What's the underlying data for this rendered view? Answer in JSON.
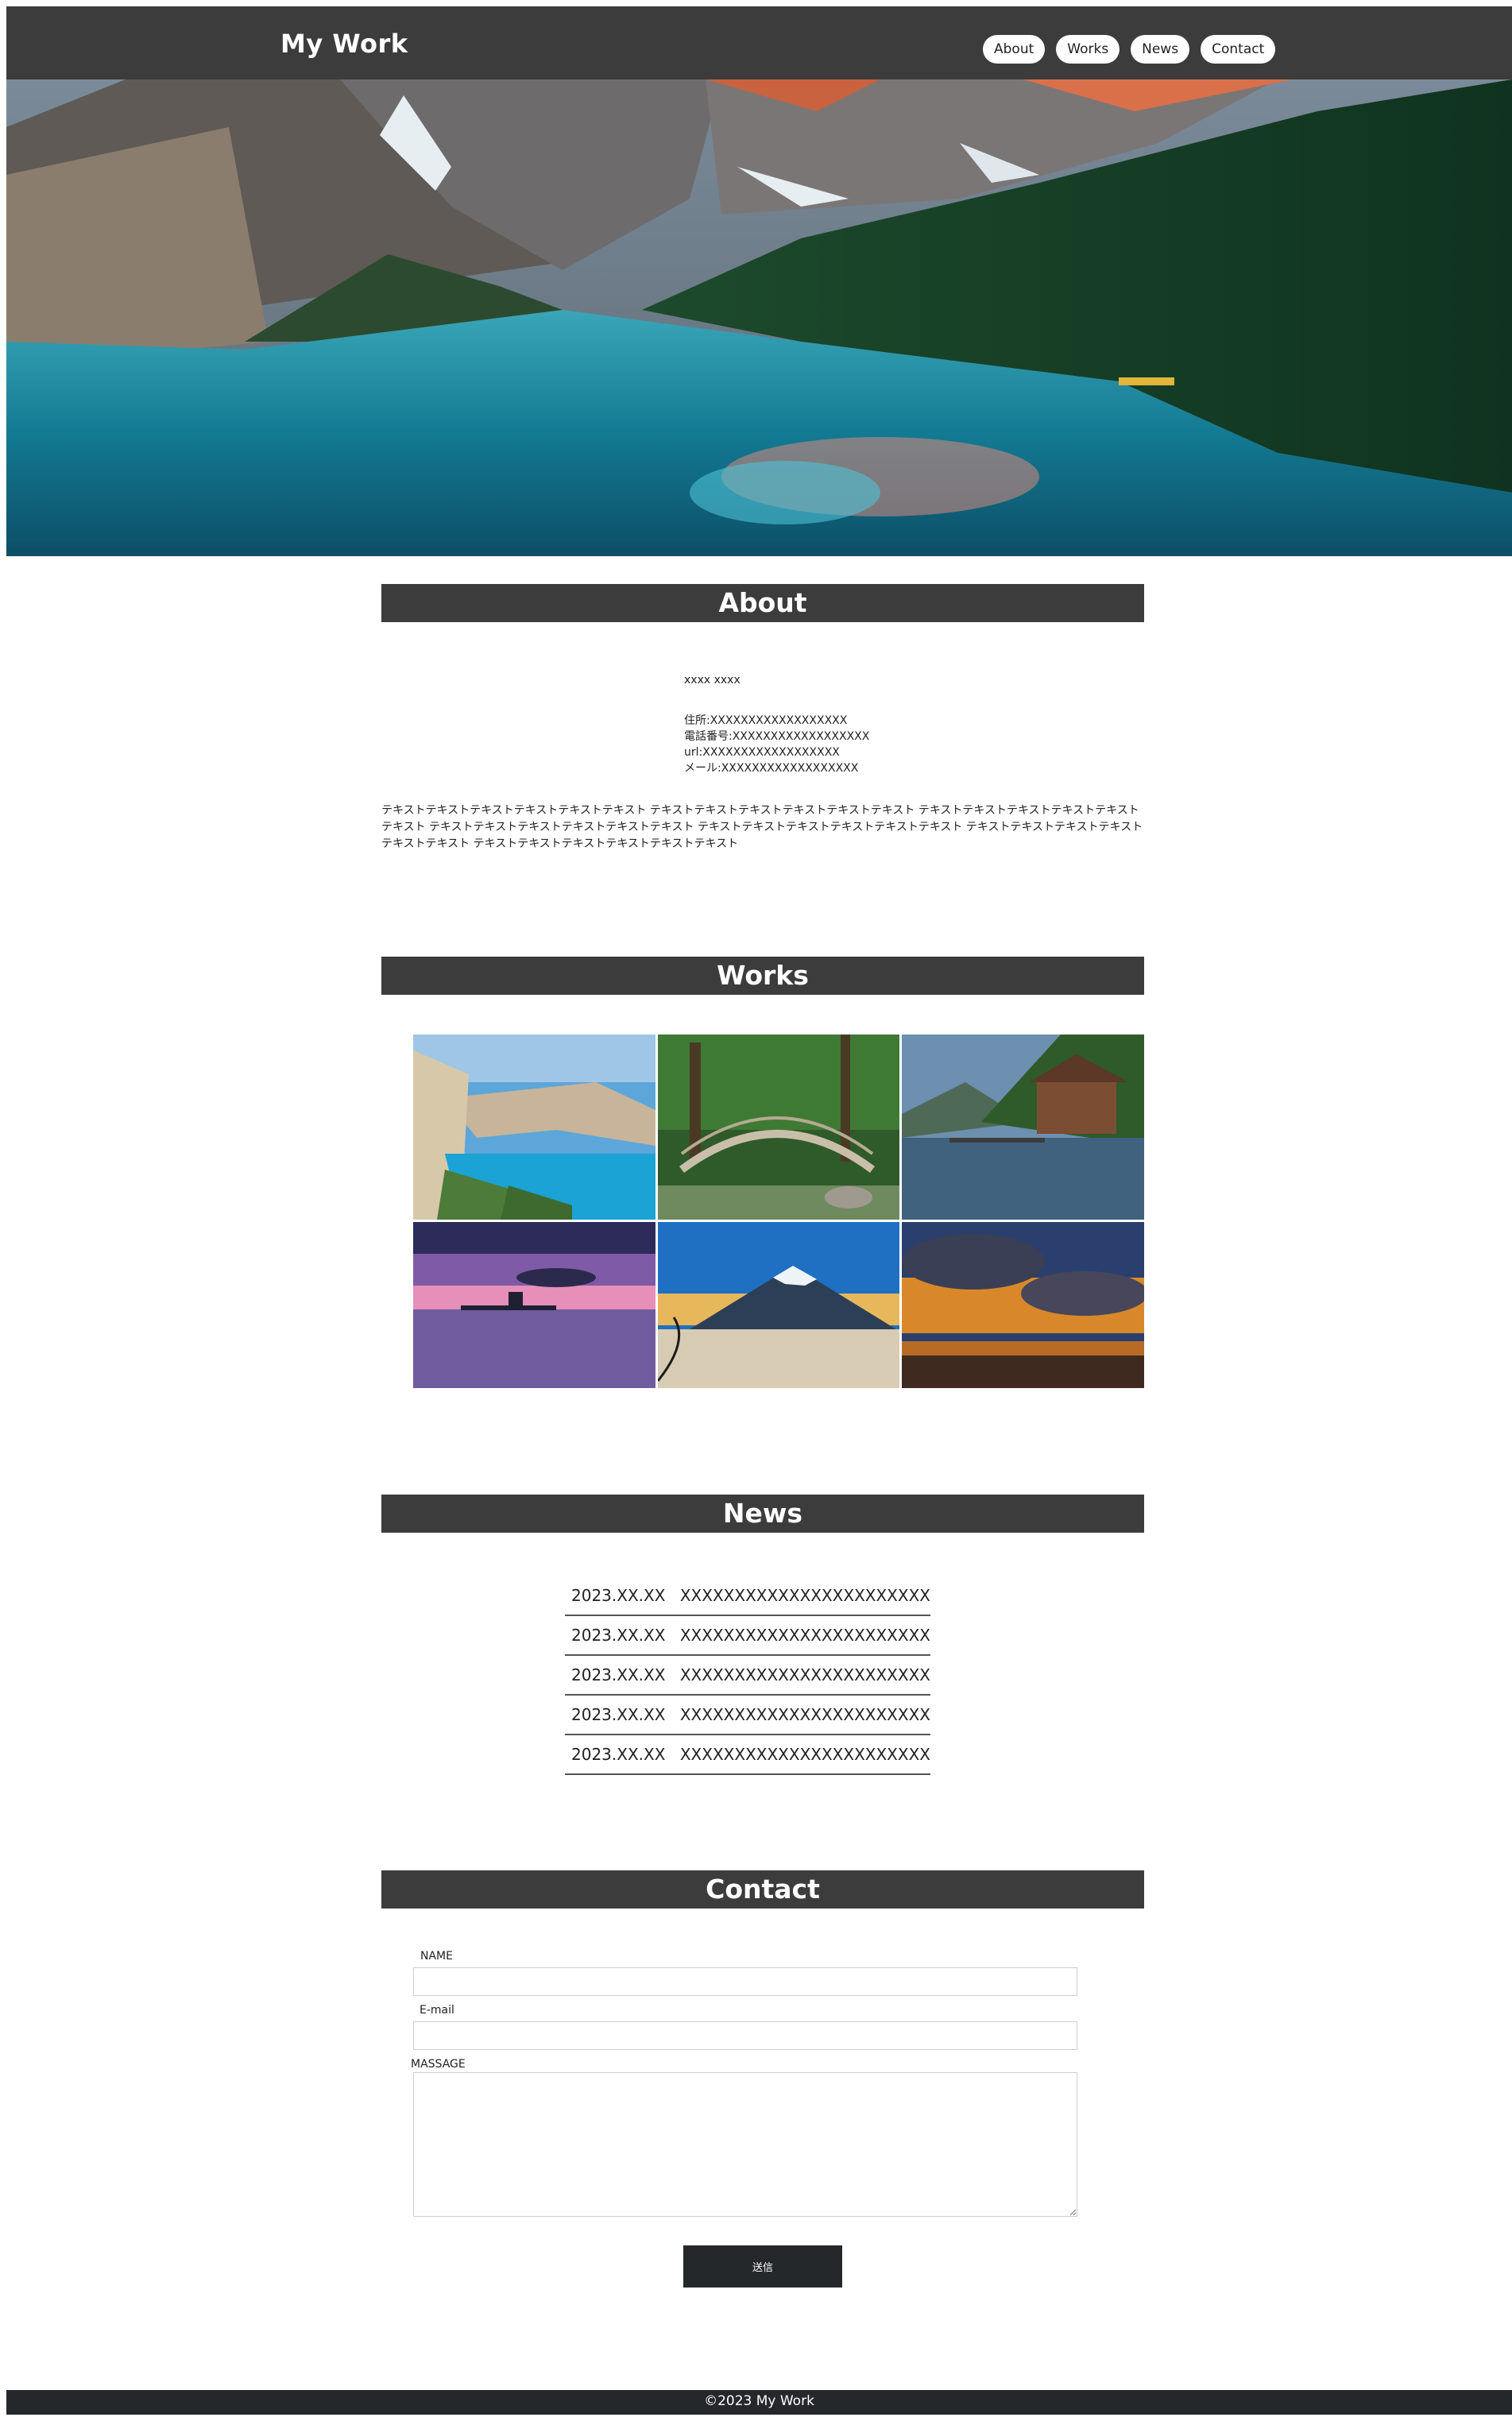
{
  "header": {
    "title": "My Work",
    "nav": [
      "About",
      "Works",
      "News",
      "Contact"
    ]
  },
  "hero": {
    "image": "mountain-lake-forest-photo"
  },
  "about": {
    "heading": "About",
    "name": "xxxx xxxx",
    "address": "住所:XXXXXXXXXXXXXXXXXX",
    "phone": "電話番号:XXXXXXXXXXXXXXXXXX",
    "url": "url:XXXXXXXXXXXXXXXXXX",
    "mail": "メール:XXXXXXXXXXXXXXXXXX",
    "text": "テキストテキストテキストテキストテキストテキスト テキストテキストテキストテキストテキストテキスト テキストテキストテキストテキストテキストテキスト テキストテキストテキストテキストテキストテキスト テキストテキストテキストテキストテキストテキスト テキストテキストテキストテキストテキストテキスト テキストテキストテキストテキストテキストテキスト"
  },
  "works": {
    "heading": "Works",
    "images": [
      "beach-cove-photo",
      "garden-bridge-photo",
      "lake-boathouse-photo",
      "sunset-pier-photo",
      "mount-fuji-photo",
      "sunset-clouds-photo"
    ]
  },
  "news": {
    "heading": "News",
    "items": [
      {
        "date": "2023.XX.XX",
        "text": "XXXXXXXXXXXXXXXXXXXXXXX"
      },
      {
        "date": "2023.XX.XX",
        "text": "XXXXXXXXXXXXXXXXXXXXXXX"
      },
      {
        "date": "2023.XX.XX",
        "text": "XXXXXXXXXXXXXXXXXXXXXXX"
      },
      {
        "date": "2023.XX.XX",
        "text": "XXXXXXXXXXXXXXXXXXXXXXX"
      },
      {
        "date": "2023.XX.XX",
        "text": "XXXXXXXXXXXXXXXXXXXXXXX"
      }
    ]
  },
  "contact": {
    "heading": "Contact",
    "name_label": "NAME",
    "email_label": "E-mail",
    "message_label": "MASSAGE",
    "submit_label": "送信"
  },
  "footer": {
    "copyright": "©2023 My Work"
  }
}
